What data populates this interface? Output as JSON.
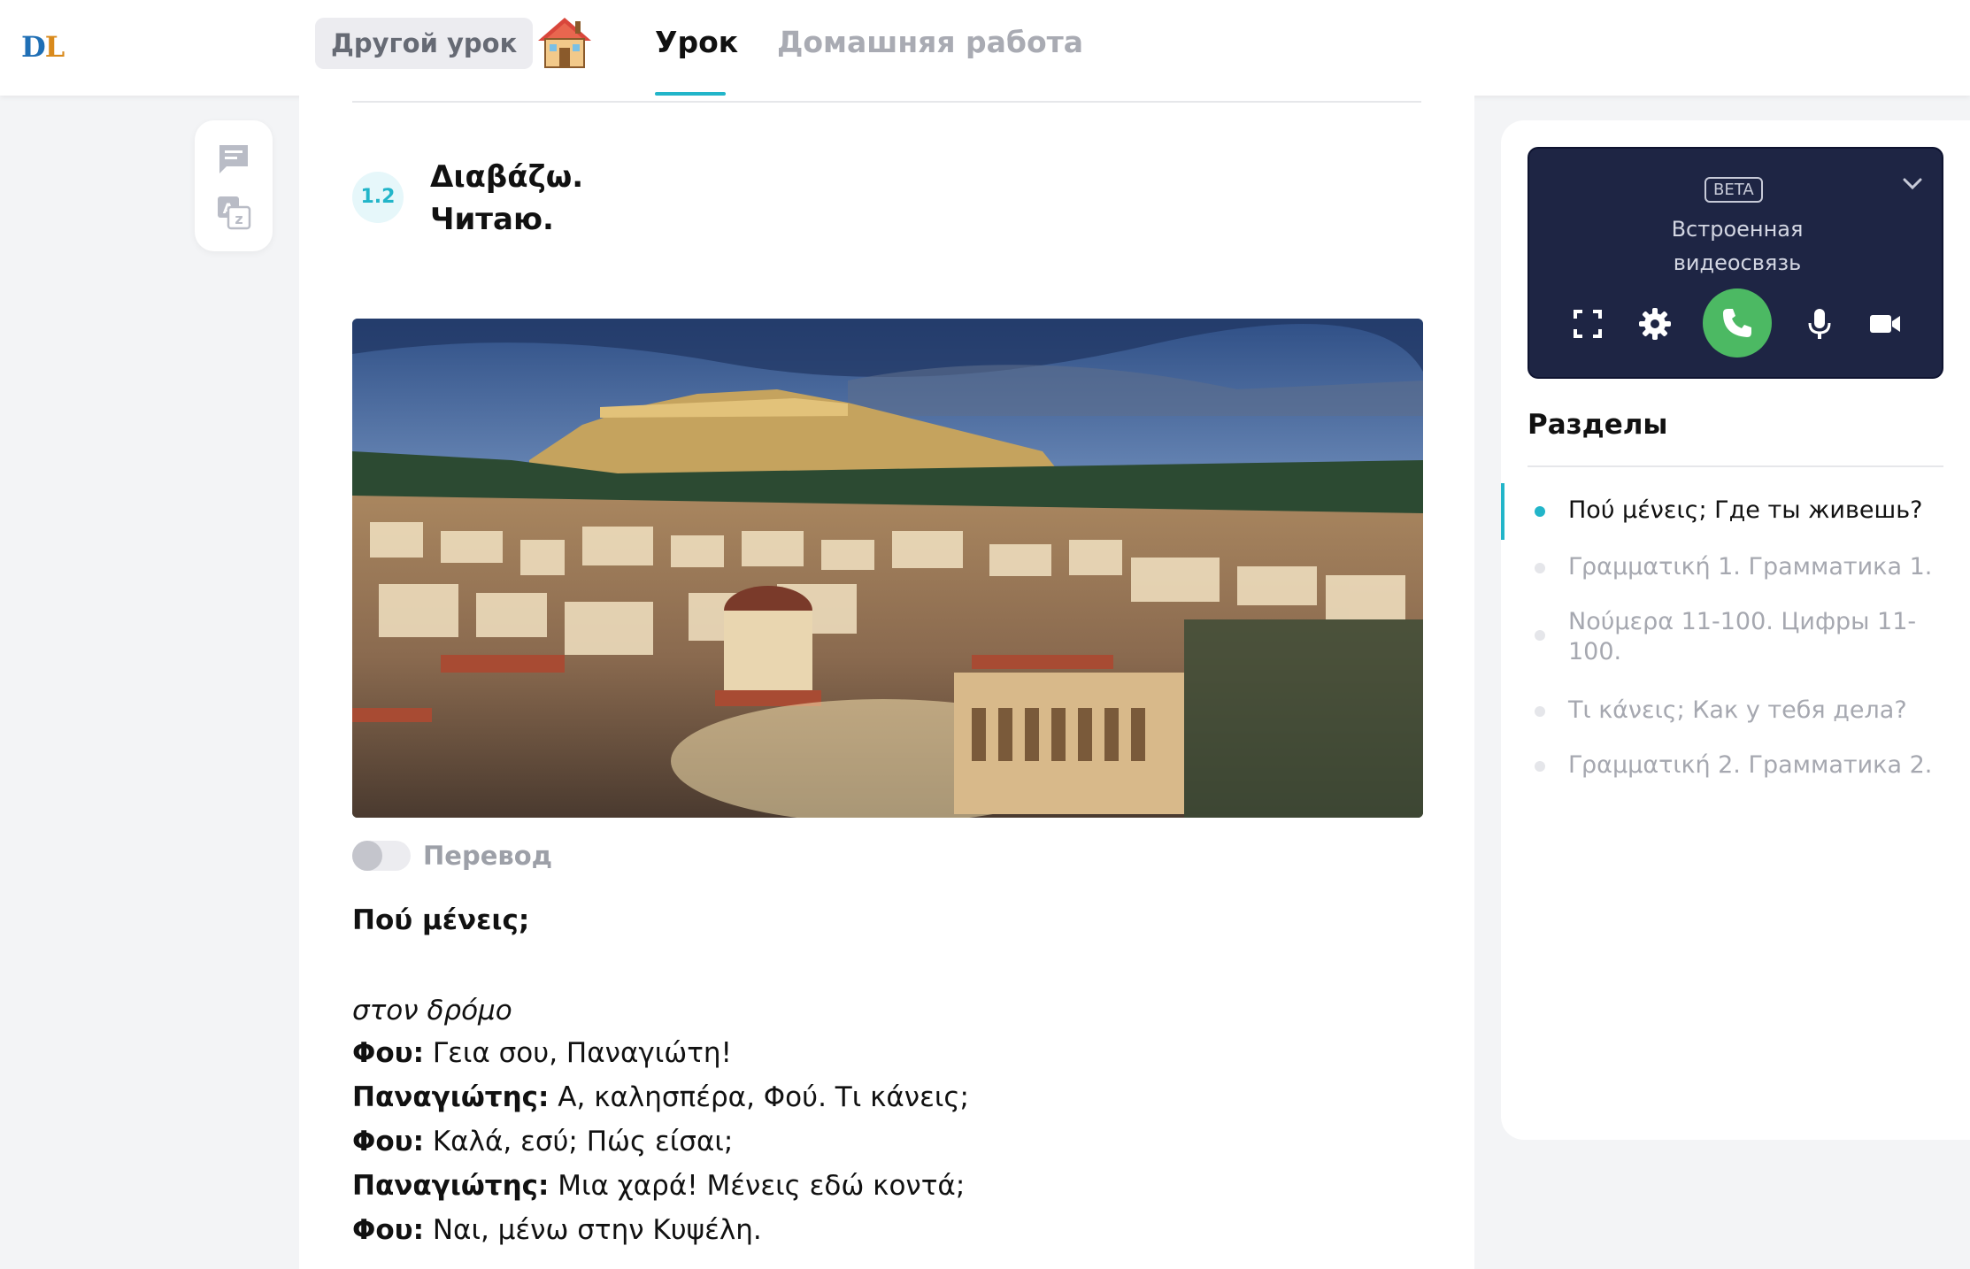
{
  "header": {
    "logo_d": "D",
    "logo_l": "L",
    "other_lesson": "Другой урок",
    "tabs": [
      {
        "label": "Урок",
        "active": true
      },
      {
        "label": "Домашняя работа",
        "active": false
      }
    ]
  },
  "lesson": {
    "section_number": "1.2",
    "section_title": "Διαβάζω.\nЧитаю.",
    "photo_icon": "athens-acropolis-photo",
    "translation_toggle_label": "Перевод",
    "translation_on": false,
    "text_heading": "Πού μένεις;",
    "text_setting": "στον δρόμο",
    "dialogue": [
      {
        "speaker": "Φου:",
        "text": " Γεια σου, Παναγιώτη!"
      },
      {
        "speaker": "Παναγιώτης:",
        "text": " Α, καλησπέρα, Φού. Τι κάνεις;"
      },
      {
        "speaker": "Φου:",
        "text": " Καλά, εσύ; Πώς είσαι;"
      },
      {
        "speaker": "Παναγιώτης:",
        "text": " Μια χαρά! Μένεις εδώ κοντά;"
      },
      {
        "speaker": "Φου:",
        "text": " Ναι, μένω στην Κυψέλη."
      }
    ]
  },
  "video": {
    "beta_label": "BETA",
    "title": "Встроенная\nвидеосвязь",
    "controls": [
      "fullscreen-icon",
      "gear-icon",
      "phone-icon",
      "microphone-icon",
      "camera-icon"
    ],
    "call_color": "#4cb963"
  },
  "sections": {
    "title": "Разделы",
    "items": [
      {
        "label": "Πού μένεις; Где ты живешь?",
        "active": true
      },
      {
        "label": "Γραμματική 1. Грамматика 1.",
        "active": false
      },
      {
        "label": "Νούμερα 11-100. Цифры 11-100.",
        "active": false
      },
      {
        "label": "Τι κάνεις; Как у тебя дела?",
        "active": false
      },
      {
        "label": "Γραμματική 2. Грамматика 2.",
        "active": false
      }
    ]
  },
  "colors": {
    "accent": "#22b5c9",
    "video_bg": "#1e2544"
  }
}
